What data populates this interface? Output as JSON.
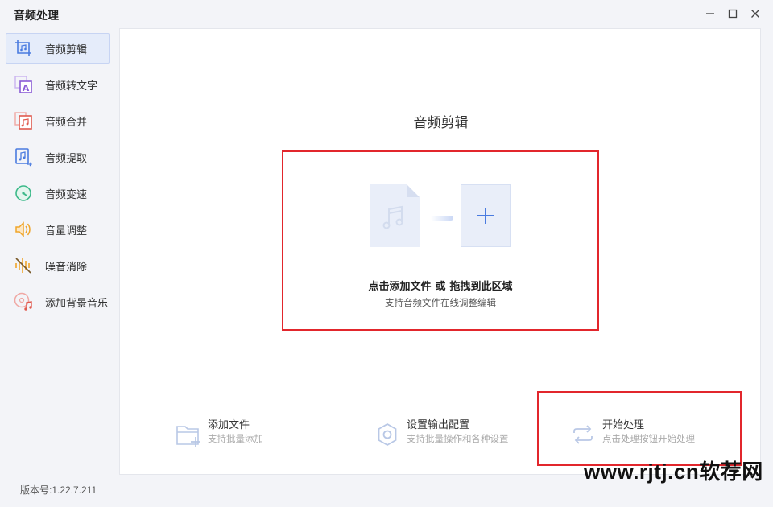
{
  "window": {
    "title": "音频处理",
    "minimize_glyph": "—",
    "maximize_glyph": "☐",
    "close_glyph": "✕"
  },
  "sidebar": {
    "items": [
      {
        "label": "音频剪辑",
        "icon": "crop-music-icon",
        "active": true
      },
      {
        "label": "音频转文字",
        "icon": "audio-to-text-icon",
        "active": false
      },
      {
        "label": "音频合并",
        "icon": "audio-merge-icon",
        "active": false
      },
      {
        "label": "音频提取",
        "icon": "audio-extract-icon",
        "active": false
      },
      {
        "label": "音频变速",
        "icon": "speed-gauge-icon",
        "active": false
      },
      {
        "label": "音量调整",
        "icon": "volume-icon",
        "active": false
      },
      {
        "label": "噪音消除",
        "icon": "noise-reduction-icon",
        "active": false
      },
      {
        "label": "添加背景音乐",
        "icon": "background-music-icon",
        "active": false
      }
    ]
  },
  "version": "版本号:1.22.7.211",
  "main": {
    "title": "音频剪辑",
    "dropzone": {
      "click_add": "点击添加文件",
      "or": "或",
      "drag_here": "拖拽到此区域",
      "subtitle": "支持音频文件在线调整编辑"
    },
    "actions": [
      {
        "title": "添加文件",
        "subtitle": "支持批量添加",
        "icon": "add-folder-icon"
      },
      {
        "title": "设置输出配置",
        "subtitle": "支持批量操作和各种设置",
        "icon": "gear-icon"
      },
      {
        "title": "开始处理",
        "subtitle": "点击处理按钮开始处理",
        "icon": "refresh-process-icon"
      }
    ]
  },
  "watermark": "www.rjtj.cn软荐网",
  "colors": {
    "accent": "#4a7be0",
    "highlight_border": "#e2262c",
    "active_bg": "#e5ecfa"
  }
}
